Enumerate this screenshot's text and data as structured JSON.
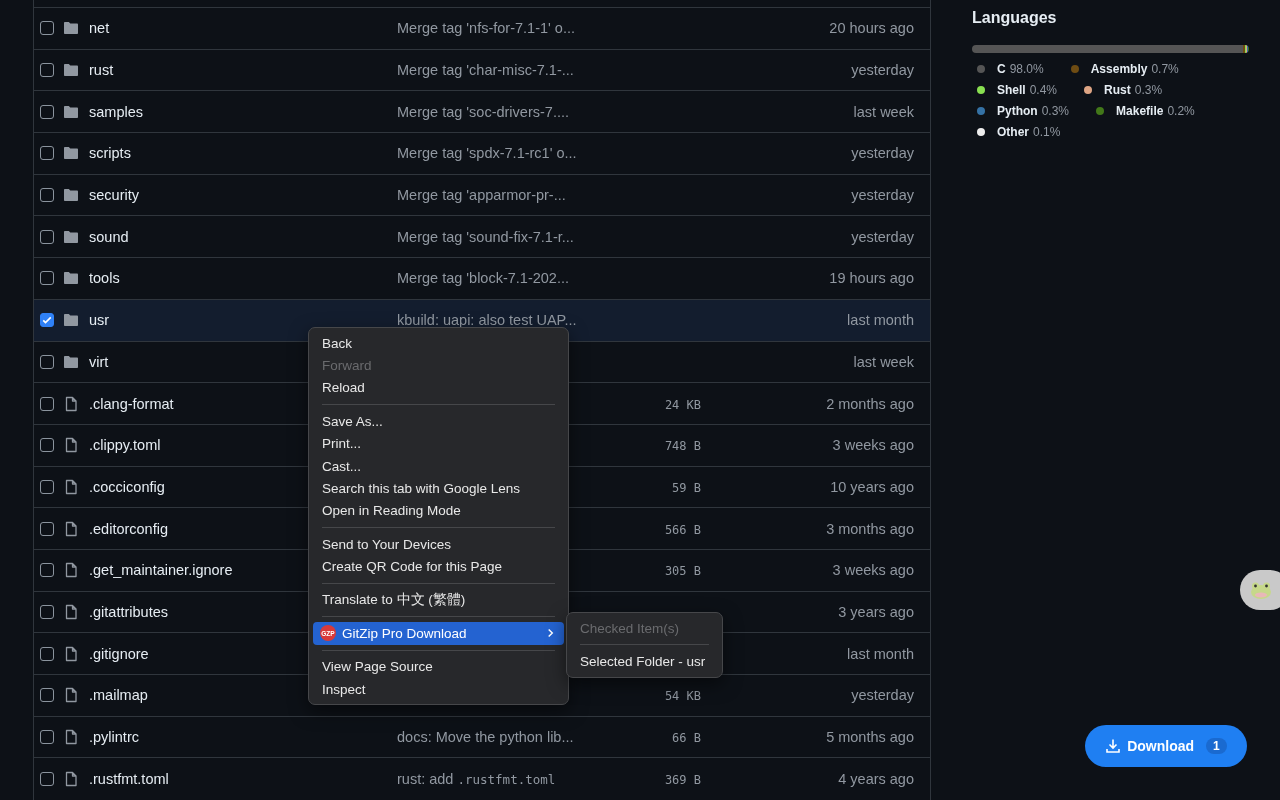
{
  "files": [
    {
      "kind": "folder",
      "checked": false,
      "name": "net",
      "message": "Merge tag 'nfs-for-7.1-1' o...",
      "time": "20 hours ago"
    },
    {
      "kind": "folder",
      "checked": false,
      "name": "rust",
      "message": "Merge tag 'char-misc-7.1-...",
      "time": "yesterday"
    },
    {
      "kind": "folder",
      "checked": false,
      "name": "samples",
      "message": "Merge tag 'soc-drivers-7....",
      "time": "last week"
    },
    {
      "kind": "folder",
      "checked": false,
      "name": "scripts",
      "message": "Merge tag 'spdx-7.1-rc1' o...",
      "time": "yesterday"
    },
    {
      "kind": "folder",
      "checked": false,
      "name": "security",
      "message": "Merge tag 'apparmor-pr-...",
      "time": "yesterday"
    },
    {
      "kind": "folder",
      "checked": false,
      "name": "sound",
      "message": "Merge tag 'sound-fix-7.1-r...",
      "time": "yesterday"
    },
    {
      "kind": "folder",
      "checked": false,
      "name": "tools",
      "message": "Merge tag 'block-7.1-202...",
      "time": "19 hours ago"
    },
    {
      "kind": "folder",
      "checked": true,
      "name": "usr",
      "message": "kbuild: uapi: also test UAP...",
      "time": "last month"
    },
    {
      "kind": "folder",
      "checked": false,
      "name": "virt",
      "time": "last week"
    },
    {
      "kind": "file",
      "checked": false,
      "name": ".clang-format",
      "size": "24 KB",
      "time": "2 months ago"
    },
    {
      "kind": "file",
      "checked": false,
      "name": ".clippy.toml",
      "size": "748 B",
      "time": "3 weeks ago"
    },
    {
      "kind": "file",
      "checked": false,
      "name": ".cocciconfig",
      "size": "59 B",
      "time": "10 years ago"
    },
    {
      "kind": "file",
      "checked": false,
      "name": ".editorconfig",
      "size": "566 B",
      "time": "3 months ago"
    },
    {
      "kind": "file",
      "checked": false,
      "name": ".get_maintainer.ignore",
      "size": "305 B",
      "time": "3 weeks ago"
    },
    {
      "kind": "file",
      "checked": false,
      "name": ".gitattributes",
      "time": "3 years ago"
    },
    {
      "kind": "file",
      "checked": false,
      "name": ".gitignore",
      "time": "last month"
    },
    {
      "kind": "file",
      "checked": false,
      "name": ".mailmap",
      "size": "54 KB",
      "time": "yesterday"
    },
    {
      "kind": "file",
      "checked": false,
      "name": ".pylintrc",
      "message": "docs: Move the python lib...",
      "size": "66 B",
      "time": "5 months ago"
    },
    {
      "kind": "file",
      "checked": false,
      "name": ".rustfmt.toml",
      "message": "rust: add",
      "message_code": ".rustfmt.toml",
      "size": "369 B",
      "time": "4 years ago"
    }
  ],
  "languages": {
    "title": "Languages",
    "items": [
      {
        "name": "C",
        "percent": "98.0%",
        "color": "#555555",
        "level": 0.98
      },
      {
        "name": "Assembly",
        "percent": "0.7%",
        "color": "#6e4c13",
        "level": 0.007
      },
      {
        "name": "Shell",
        "percent": "0.4%",
        "color": "#89e051",
        "level": 0.004
      },
      {
        "name": "Rust",
        "percent": "0.3%",
        "color": "#dea584",
        "level": 0.003
      },
      {
        "name": "Python",
        "percent": "0.3%",
        "color": "#3572a5",
        "level": 0.003
      },
      {
        "name": "Makefile",
        "percent": "0.2%",
        "color": "#427819",
        "level": 0.002
      },
      {
        "name": "Other",
        "percent": "0.1%",
        "color": "#ededed",
        "level": 0.001
      }
    ]
  },
  "context_menu": {
    "groups": [
      [
        {
          "label": "Back",
          "disabled": false
        },
        {
          "label": "Forward",
          "disabled": true
        },
        {
          "label": "Reload",
          "disabled": false
        }
      ],
      [
        {
          "label": "Save As...",
          "disabled": false
        },
        {
          "label": "Print...",
          "disabled": false
        },
        {
          "label": "Cast...",
          "disabled": false
        },
        {
          "label": "Search this tab with Google Lens",
          "disabled": false
        },
        {
          "label": "Open in Reading Mode",
          "disabled": false
        }
      ],
      [
        {
          "label": "Send to Your Devices",
          "disabled": false
        },
        {
          "label": "Create QR Code for this Page",
          "disabled": false
        }
      ],
      [
        {
          "label": "Translate to 中文 (繁體)",
          "disabled": false
        }
      ],
      [
        {
          "label": "GitZip Pro Download",
          "disabled": false,
          "selected": true,
          "submenu": true,
          "badge": "GZP"
        }
      ],
      [
        {
          "label": "View Page Source",
          "disabled": false
        },
        {
          "label": "Inspect",
          "disabled": false
        }
      ]
    ]
  },
  "submenu": {
    "groups": [
      [
        {
          "label": "Checked Item(s)",
          "disabled": true
        }
      ],
      [
        {
          "label": "Selected Folder - usr",
          "disabled": false
        }
      ]
    ]
  },
  "download_button": {
    "label": "Download",
    "count": "1"
  }
}
